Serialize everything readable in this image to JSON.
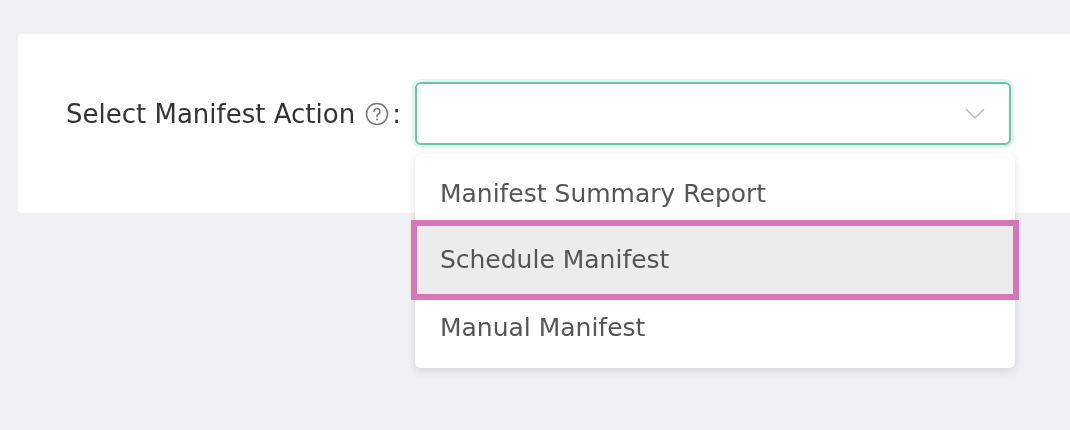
{
  "form": {
    "label": "Select Manifest Action",
    "label_suffix": ":",
    "select": {
      "focused": true,
      "expanded": true,
      "options": [
        {
          "label": "Manifest Summary Report",
          "selected": false,
          "outlined": false
        },
        {
          "label": "Schedule Manifest",
          "selected": true,
          "outlined": true
        },
        {
          "label": "Manual Manifest",
          "selected": false,
          "outlined": false
        }
      ]
    }
  }
}
